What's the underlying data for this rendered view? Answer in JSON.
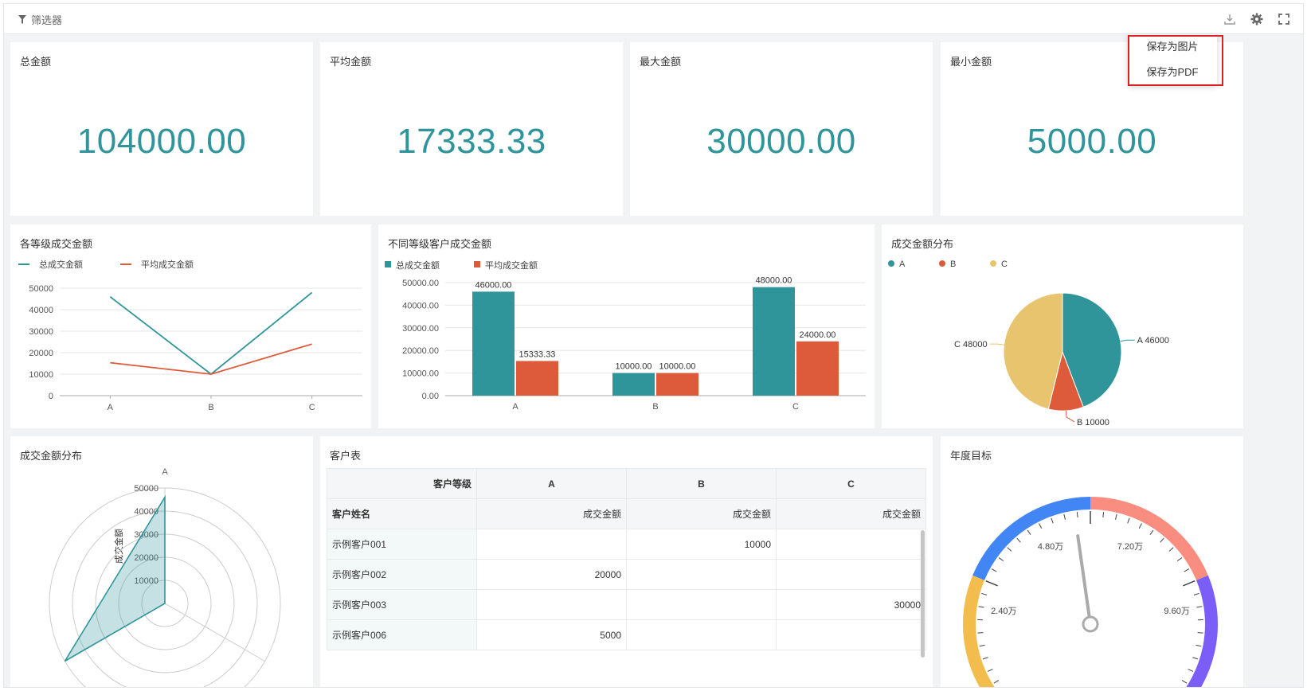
{
  "topbar": {
    "filter_label": "筛选器",
    "icons": [
      "download-icon",
      "gear-icon",
      "fullscreen-icon"
    ]
  },
  "export_menu": {
    "save_image": "保存为图片",
    "save_pdf": "保存为PDF"
  },
  "kpis": [
    {
      "title": "总金额",
      "value": "104000.00"
    },
    {
      "title": "平均金额",
      "value": "17333.33"
    },
    {
      "title": "最大金额",
      "value": "30000.00"
    },
    {
      "title": "最小金额",
      "value": "5000.00"
    }
  ],
  "colors": {
    "teal": "#2f959a",
    "orange": "#dd5b3b",
    "yellow": "#e8c46f",
    "kpi": "#2f959a"
  },
  "chart_data": [
    {
      "type": "line",
      "title": "各等级成交金额",
      "categories": [
        "A",
        "B",
        "C"
      ],
      "series": [
        {
          "name": "总成交金额",
          "values": [
            46000,
            10000,
            48000
          ]
        },
        {
          "name": "平均成交金额",
          "values": [
            15333.33,
            10000,
            24000
          ]
        }
      ],
      "ylim": [
        0,
        50000
      ],
      "yticks": [
        "0",
        "10000",
        "20000",
        "30000",
        "40000",
        "50000"
      ],
      "legend": "top-left",
      "grid": true
    },
    {
      "type": "bar",
      "title": "不同等级客户成交金额",
      "categories": [
        "A",
        "B",
        "C"
      ],
      "series": [
        {
          "name": "总成交金额",
          "values": [
            46000,
            10000,
            48000
          ],
          "labels": [
            "46000.00",
            "10000.00",
            "48000.00"
          ]
        },
        {
          "name": "平均成交金额",
          "values": [
            15333.33,
            10000,
            24000
          ],
          "labels": [
            "15333.33",
            "10000.00",
            "24000.00"
          ]
        }
      ],
      "ylim": [
        0,
        50000
      ],
      "yticks": [
        "0.00",
        "10000.00",
        "20000.00",
        "30000.00",
        "40000.00",
        "50000.00"
      ],
      "legend": "top-left",
      "grid": true
    },
    {
      "type": "pie",
      "title": "成交金额分布",
      "categories": [
        "A",
        "B",
        "C"
      ],
      "values": [
        46000,
        10000,
        48000
      ],
      "labels": [
        "A 46000",
        "B 10000",
        "C 48000"
      ],
      "legend": "top-left"
    },
    {
      "type": "radar",
      "title": "成交金额分布",
      "indicator_visible": "A",
      "axis_name": "成交金额",
      "rticks": [
        "10000",
        "20000",
        "30000",
        "40000",
        "50000"
      ],
      "rmax": 50000,
      "values": [
        46000
      ]
    }
  ],
  "table": {
    "title": "客户表",
    "header_label": "客户等级",
    "groups": [
      "A",
      "B",
      "C"
    ],
    "row_header": "客户姓名",
    "measure": "成交金额",
    "rows": [
      {
        "name": "示例客户001",
        "A": "",
        "B": "10000",
        "C": ""
      },
      {
        "name": "示例客户002",
        "A": "20000",
        "B": "",
        "C": ""
      },
      {
        "name": "示例客户003",
        "A": "",
        "B": "",
        "C": "30000"
      },
      {
        "name": "示例客户006",
        "A": "5000",
        "B": "",
        "C": ""
      }
    ]
  },
  "gauge": {
    "title": "年度目标",
    "ticks": [
      "2.40万",
      "4.80万",
      "7.20万",
      "9.60万"
    ],
    "value_fraction": 0.47
  }
}
